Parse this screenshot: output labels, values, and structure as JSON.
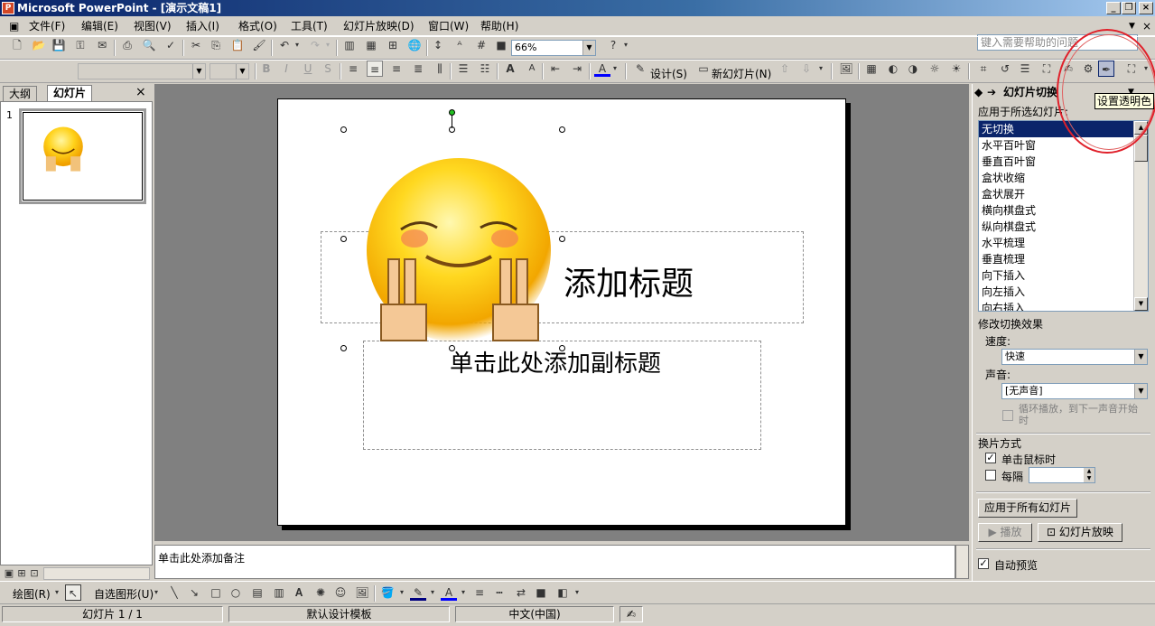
{
  "window": {
    "title": "Microsoft PowerPoint - [演示文稿1]",
    "app_icon_letter": "P"
  },
  "menu": {
    "items": [
      "文件(F)",
      "编辑(E)",
      "视图(V)",
      "插入(I)",
      "格式(O)",
      "工具(T)",
      "幻灯片放映(D)",
      "窗口(W)",
      "帮助(H)"
    ],
    "help_placeholder": "键入需要帮助的问题"
  },
  "standard_toolbar": {
    "zoom": "66%"
  },
  "formatting_toolbar": {
    "font_name": "",
    "font_size": "",
    "design_label": "设计(S)",
    "new_slide_label": "新幻灯片(N)"
  },
  "left_pane": {
    "tabs": [
      "大纲",
      "幻灯片"
    ],
    "active_tab": "幻灯片",
    "close": "×",
    "slide_number": "1"
  },
  "slide": {
    "title_placeholder": "添加标题",
    "subtitle_placeholder": "单击此处添加副标题",
    "image": "smiley-peace-sign"
  },
  "notes": {
    "placeholder": "单击此处添加备注"
  },
  "task_pane": {
    "title": "幻灯片切换",
    "apply_to_label": "应用于所选幻灯片:",
    "transitions": [
      "无切换",
      "水平百叶窗",
      "垂直百叶窗",
      "盒状收缩",
      "盒状展开",
      "横向棋盘式",
      "纵向棋盘式",
      "水平梳理",
      "垂直梳理",
      "向下插入",
      "向左插入",
      "向右插入"
    ],
    "selected_transition": "无切换",
    "modify_label": "修改切换效果",
    "speed_label": "速度:",
    "speed_value": "快速",
    "sound_label": "声音:",
    "sound_value": "[无声音]",
    "loop_label": "循环播放，到下一声音开始时",
    "advance_label": "换片方式",
    "on_click_label": "单击鼠标时",
    "on_click_checked": true,
    "auto_label": "每隔",
    "auto_checked": false,
    "apply_all_button": "应用于所有幻灯片",
    "play_button": "播放",
    "slideshow_button": "幻灯片放映",
    "autopreview_label": "自动预览",
    "autopreview_checked": true
  },
  "tooltip": {
    "text": "设置透明色"
  },
  "drawing_toolbar": {
    "draw_label": "绘图(R)",
    "autoshapes_label": "自选图形(U)"
  },
  "status_bar": {
    "slide_pos": "幻灯片 1 / 1",
    "design": "默认设计模板",
    "language": "中文(中国)"
  },
  "colors": {
    "title_bar": "#0a246a",
    "selection": "#0a246a",
    "annotation": "#e0202a",
    "tooltip_bg": "#ffffe1"
  }
}
